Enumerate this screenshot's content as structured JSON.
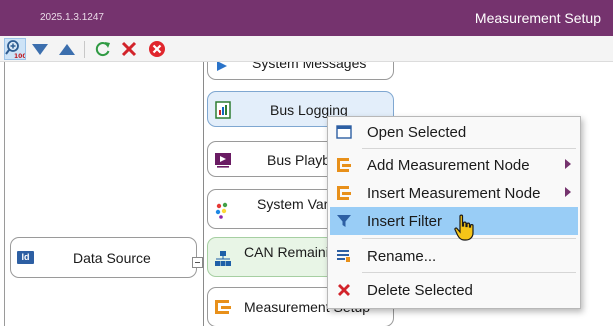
{
  "window": {
    "version": "2025.1.3.1247",
    "title": "Measurement Setup",
    "accent": "#75336e"
  },
  "toolbar": {
    "buttons": [
      {
        "icon": "zoom-100-icon",
        "tooltip": "",
        "badge": "100"
      },
      {
        "icon": "arrow-down-icon"
      },
      {
        "icon": "arrow-up-icon"
      },
      {
        "icon": "refresh-icon"
      },
      {
        "icon": "close-x-icon"
      },
      {
        "icon": "cancel-circle-icon"
      }
    ]
  },
  "nodes": {
    "system_messages": "System Messages",
    "bus_logging": "Bus Logging",
    "bus_playback": "Bus Playback",
    "system_variables": "System Variables",
    "can_remaining": "CAN Remaining",
    "measurement_setup": "Measurement Setup",
    "data_source": "Data Source",
    "data_source_badge": "Id"
  },
  "context_menu": {
    "items": [
      {
        "label": "Open Selected",
        "icon": "window-icon",
        "submenu": false
      },
      {
        "label": "Add Measurement Node",
        "icon": "node-icon",
        "submenu": true
      },
      {
        "label": "Insert Measurement Node",
        "icon": "node-icon",
        "submenu": true
      },
      {
        "label": "Insert Filter",
        "icon": "filter-icon",
        "submenu": false,
        "highlighted": true
      },
      {
        "label": "Rename...",
        "icon": "rename-icon",
        "submenu": false
      },
      {
        "label": "Delete Selected",
        "icon": "delete-icon",
        "submenu": false
      }
    ],
    "highlight_color": "#99cdf6"
  }
}
